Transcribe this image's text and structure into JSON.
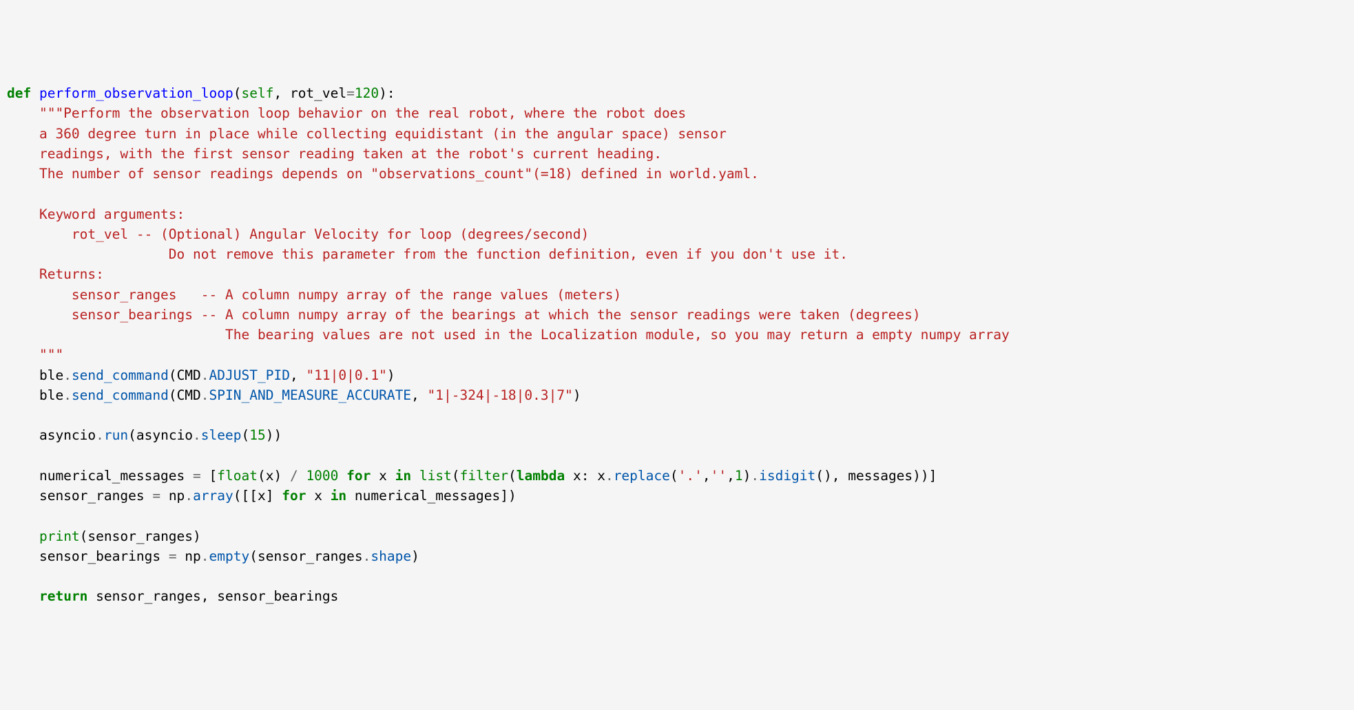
{
  "code": {
    "line1": {
      "def": "def",
      "fname": "perform_observation_loop",
      "self": "self",
      "arg": "rot_vel",
      "eq": "=",
      "val": "120",
      "close": "):"
    },
    "docstring": "    \"\"\"Perform the observation loop behavior on the real robot, where the robot does\n    a 360 degree turn in place while collecting equidistant (in the angular space) sensor\n    readings, with the first sensor reading taken at the robot's current heading.\n    The number of sensor readings depends on \"observations_count\"(=18) defined in world.yaml.\n\n    Keyword arguments:\n        rot_vel -- (Optional) Angular Velocity for loop (degrees/second)\n                    Do not remove this parameter from the function definition, even if you don't use it.\n    Returns:\n        sensor_ranges   -- A column numpy array of the range values (meters)\n        sensor_bearings -- A column numpy array of the bearings at which the sensor readings were taken (degrees)\n                           The bearing values are not used in the Localization module, so you may return a empty numpy array\n    \"\"\"",
    "ble1": {
      "pre": "    ble",
      "dot1": ".",
      "send": "send_command",
      "open": "(CMD",
      "dot2": ".",
      "cmd": "ADJUST_PID",
      "comma": ", ",
      "arg": "\"11|0|0.1\"",
      "close": ")"
    },
    "ble2": {
      "pre": "    ble",
      "dot1": ".",
      "send": "send_command",
      "open": "(CMD",
      "dot2": ".",
      "cmd": "SPIN_AND_MEASURE_ACCURATE",
      "comma": ", ",
      "arg": "\"1|-324|-18|0.3|7\"",
      "close": ")"
    },
    "asyncio": {
      "pre": "    asyncio",
      "dot1": ".",
      "run": "run",
      "open": "(asyncio",
      "dot2": ".",
      "sleep": "sleep",
      "paren": "(",
      "val": "15",
      "close": "))"
    },
    "numerical": {
      "pre": "    numerical_messages ",
      "eq": "=",
      "sp": " [",
      "float": "float",
      "open1": "(x) ",
      "div": "/",
      "sp2": " ",
      "thousand": "1000",
      "sp3": " ",
      "for": "for",
      "sp4": " x ",
      "in": "in",
      "sp5": " ",
      "list": "list",
      "open2": "(",
      "filter": "filter",
      "open3": "(",
      "lambda": "lambda",
      "sp6": " x: x",
      "dot1": ".",
      "replace": "replace",
      "open4": "(",
      "dot": "'.'",
      "comma1": ",",
      "empty": "''",
      "comma2": ",",
      "one": "1",
      "close1": ")",
      "dot2": ".",
      "isdigit": "isdigit",
      "close2": "(), messages))]"
    },
    "sensor_ranges": {
      "pre": "    sensor_ranges ",
      "eq": "=",
      "sp": " np",
      "dot": ".",
      "array": "array",
      "open": "([[x] ",
      "for": "for",
      "sp2": " x ",
      "in": "in",
      "close": " numerical_messages])"
    },
    "print": {
      "pre": "    ",
      "print": "print",
      "args": "(sensor_ranges)"
    },
    "sensor_bearings": {
      "pre": "    sensor_bearings ",
      "eq": "=",
      "sp": " np",
      "dot": ".",
      "empty": "empty",
      "open": "(sensor_ranges",
      "dot2": ".",
      "shape": "shape",
      "close": ")"
    },
    "return": {
      "pre": "    ",
      "ret": "return",
      "vals": " sensor_ranges, sensor_bearings"
    }
  }
}
